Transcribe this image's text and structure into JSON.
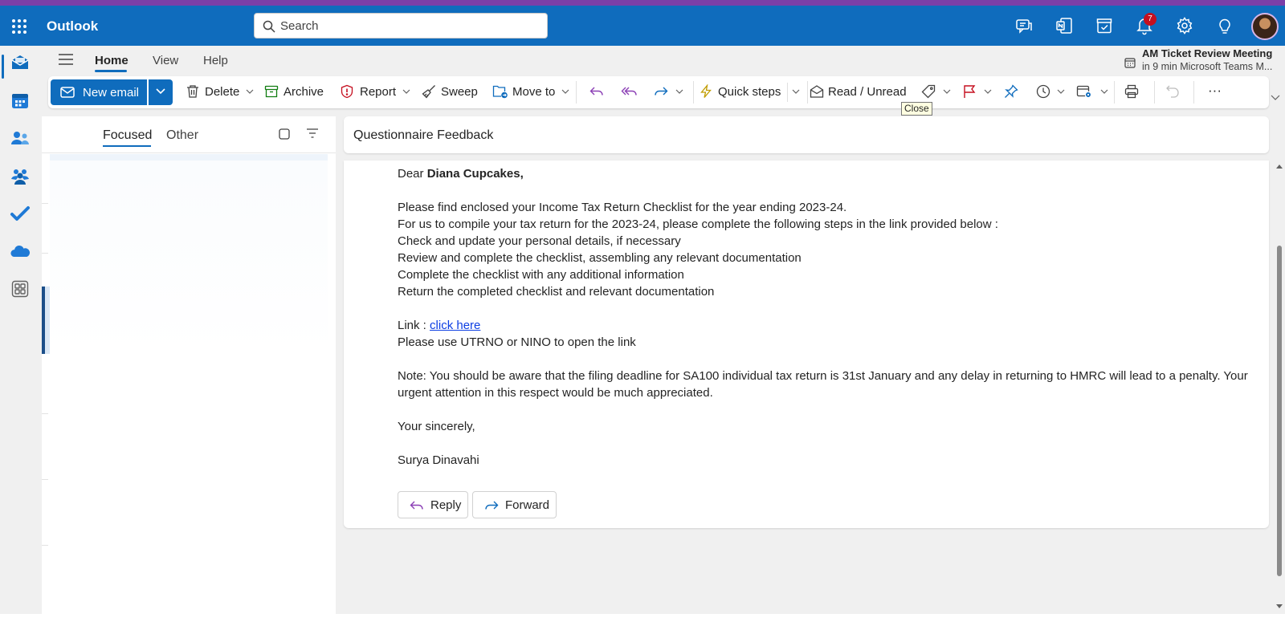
{
  "app": {
    "title": "Outlook"
  },
  "search": {
    "placeholder": "Search"
  },
  "notifications": {
    "count": "7"
  },
  "top_icons": [
    "teams-chat-icon",
    "onenote-icon",
    "my-day-icon",
    "bell-icon",
    "gear-icon",
    "lightbulb-icon"
  ],
  "rail": [
    "mail-icon",
    "calendar-icon",
    "people-icon",
    "groups-icon",
    "todo-icon",
    "onedrive-icon",
    "apps-icon"
  ],
  "tabs": [
    {
      "label": "Home",
      "active": true
    },
    {
      "label": "View",
      "active": false
    },
    {
      "label": "Help",
      "active": false
    }
  ],
  "meeting": {
    "title": "AM Ticket Review Meeting",
    "subtitle": "in 9 min Microsoft Teams M..."
  },
  "ribbon": {
    "new_email": "New email",
    "delete": "Delete",
    "archive": "Archive",
    "report": "Report",
    "sweep": "Sweep",
    "move_to": "Move to",
    "quick_steps": "Quick steps",
    "read_unread": "Read / Unread",
    "more": "···"
  },
  "tooltip": {
    "text": "Close"
  },
  "mail_list": {
    "pivots": {
      "focused": "Focused",
      "other": "Other"
    }
  },
  "reading": {
    "subject": "Questionnaire Feedback",
    "greeting_prefix": "Dear ",
    "recipient": "Diana Cupcakes,",
    "lines": [
      "Please find enclosed your Income Tax Return Checklist for the year ending 2023-24.",
      "For us to compile your tax return for the 2023-24, please complete the following steps in the link provided below :",
      "Check and update your personal details, if necessary",
      "Review and complete the checklist, assembling any relevant documentation",
      "Complete the checklist with any additional information",
      "Return the completed checklist and relevant documentation"
    ],
    "link_prefix": "Link : ",
    "link_text": "click here",
    "link_note": "Please use UTRNO or NINO to open the link",
    "note": "Note: You should be aware that the filing deadline for SA100 individual tax return is 31st January and any delay in returning to HMRC will lead to a penalty. Your urgent attention in this respect would be much appreciated.",
    "closing": "Your sincerely,",
    "signature": "Surya Dinavahi",
    "reply_label": "Reply",
    "forward_label": "Forward"
  },
  "colors": {
    "brand": "#0f6cbd",
    "accent_stripe": "#7b3fa8",
    "link": "#0c3ee3",
    "flag": "#c50f1f"
  }
}
